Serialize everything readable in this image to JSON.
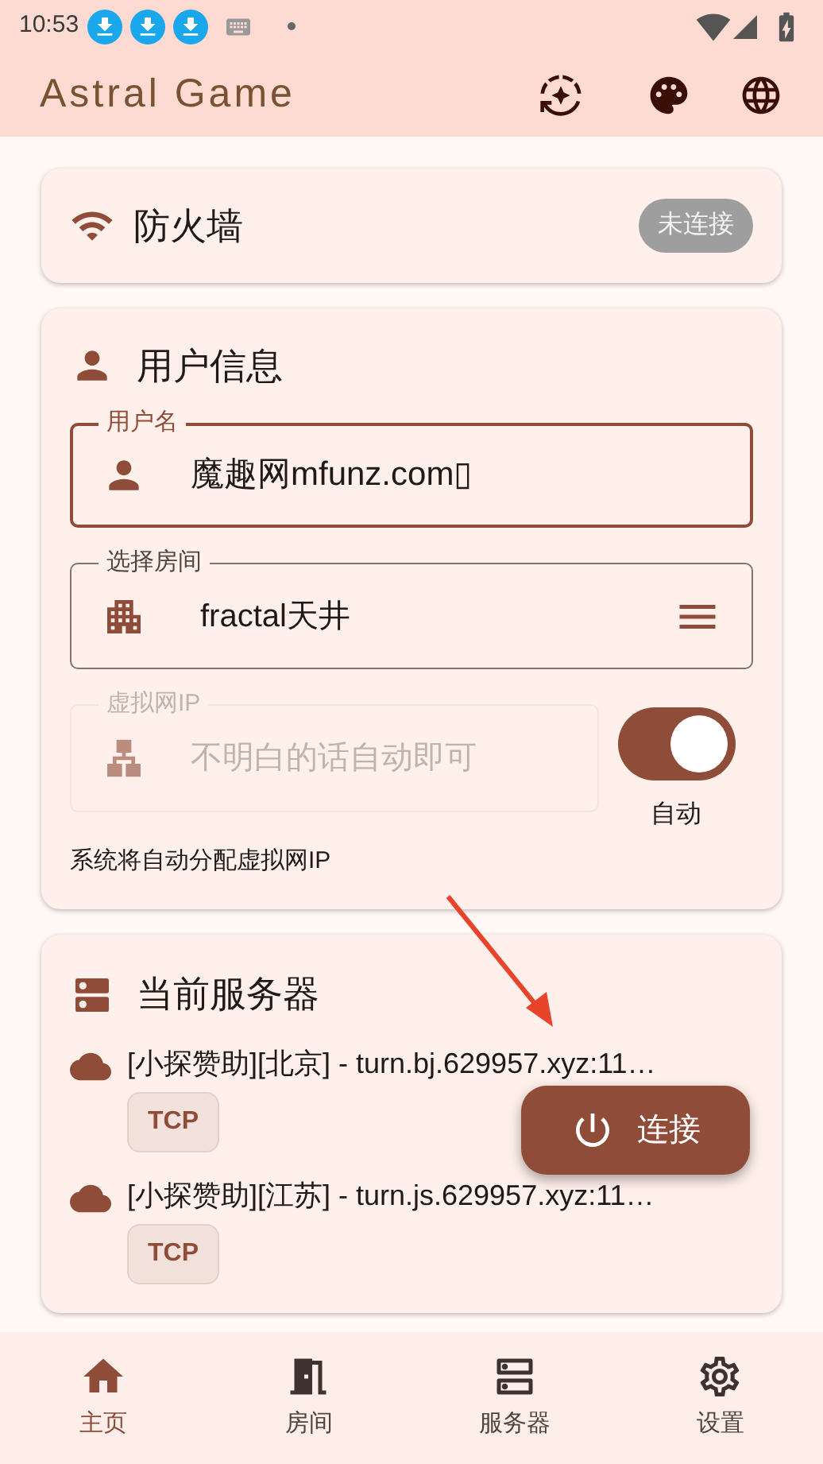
{
  "status_bar": {
    "time": "10:53"
  },
  "app_bar": {
    "title": "Astral Game"
  },
  "firewall": {
    "title": "防火墙",
    "status": "未连接",
    "connected": false
  },
  "user_info": {
    "title": "用户信息",
    "username": {
      "label": "用户名",
      "value": "魔趣网mfunz.com▯",
      "focused": true
    },
    "room": {
      "label": "选择房间",
      "value": "fractal天井"
    },
    "virtual_ip": {
      "label": "虚拟网IP",
      "placeholder": "不明白的话自动即可",
      "disabled": true
    },
    "auto_switch": {
      "label": "自动",
      "on": true
    },
    "hint": "系统将自动分配虚拟网IP"
  },
  "servers": {
    "title": "当前服务器",
    "items": [
      {
        "name": "[小探赞助][北京] - turn.bj.629957.xyz:11…",
        "protocol": "TCP"
      },
      {
        "name": "[小探赞助][江苏] - turn.js.629957.xyz:11…",
        "protocol": "TCP"
      }
    ]
  },
  "fab": {
    "label": "连接"
  },
  "nav": [
    {
      "kind": "home",
      "label": "主页",
      "selected": true
    },
    {
      "kind": "room",
      "label": "房间",
      "selected": false
    },
    {
      "kind": "server",
      "label": "服务器",
      "selected": false
    },
    {
      "kind": "settings",
      "label": "设置",
      "selected": false
    }
  ]
}
